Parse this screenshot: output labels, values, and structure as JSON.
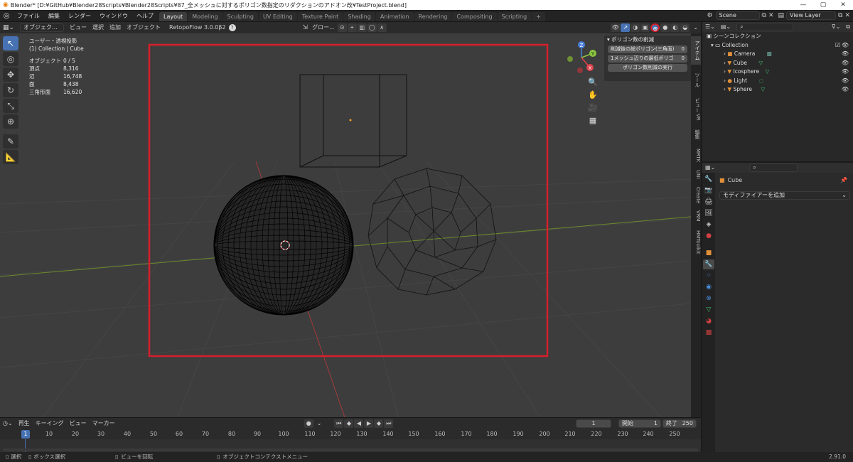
{
  "window": {
    "title": "Blender* [D:¥GitHub¥Blender28Scripts¥Blender28Scripts¥87_全メッシュに対するポリゴン数指定のリダクションのアドオン改¥TestProject.blend]",
    "min": "—",
    "max": "▢",
    "close": "✕"
  },
  "menu": [
    "ファイル",
    "編集",
    "レンダー",
    "ウィンドウ",
    "ヘルプ"
  ],
  "workspaces": [
    "Layout",
    "Modeling",
    "Sculpting",
    "UV Editing",
    "Texture Paint",
    "Shading",
    "Animation",
    "Rendering",
    "Compositing",
    "Scripting"
  ],
  "workspace_add": "+",
  "scene": {
    "name": "Scene",
    "view_layer": "View Layer"
  },
  "viewport_header": {
    "mode": "オブジェク...",
    "menus": [
      "ビュー",
      "選択",
      "追加",
      "オブジェクト"
    ],
    "addon": "RetopoFlow 3.0.0β2",
    "addon_help": "?",
    "transform": "グロー..."
  },
  "overlay_stats": {
    "title": "ユーザー・透視投影",
    "subtitle": "(1) Collection | Cube",
    "rows": [
      {
        "k": "オブジェクト",
        "v": "0 / 5"
      },
      {
        "k": "頂点",
        "v": "8,316"
      },
      {
        "k": "辺",
        "v": "16,748"
      },
      {
        "k": "面",
        "v": "8,438"
      },
      {
        "k": "三角形面",
        "v": "16,620"
      }
    ]
  },
  "gizmo": {
    "z": "Z",
    "y": "Y",
    "x": "X"
  },
  "npanel": {
    "header": "ポリゴン数の削減",
    "fields": [
      {
        "label": "削減後の総ポリゴン(三角面)",
        "value": "0"
      },
      {
        "label": "1メッシュ辺りの最低ポリゴ",
        "value": "0"
      }
    ],
    "run_button": "ポリゴン数削減の実行"
  },
  "side_tabs": [
    "アイテム",
    "ツール",
    "ビュー",
    "VR",
    "編集",
    "MRTK",
    "UNI",
    "Create",
    "VRM",
    "HMToolkit"
  ],
  "outliner": {
    "search_placeholder": "",
    "root": "シーンコレクション",
    "collection": "Collection",
    "items": [
      "Camera",
      "Cube",
      "Icosphere",
      "Light",
      "Sphere"
    ]
  },
  "properties": {
    "search_placeholder": "",
    "object": "Cube",
    "add_modifier": "モディファイアーを追加"
  },
  "timeline": {
    "menus": [
      "再生",
      "キーイング",
      "ビュー",
      "マーカー"
    ],
    "current_frame": "1",
    "start_label": "開始",
    "start": "1",
    "end_label": "終了",
    "end": "250",
    "ticks": [
      "1",
      "10",
      "20",
      "30",
      "40",
      "50",
      "60",
      "70",
      "80",
      "90",
      "100",
      "110",
      "120",
      "130",
      "140",
      "150",
      "160",
      "170",
      "180",
      "190",
      "200",
      "210",
      "220",
      "230",
      "240",
      "250"
    ]
  },
  "status": {
    "select": "選択",
    "box_select": "ボックス選択",
    "rotate": "ビューを回転",
    "context": "オブジェクトコンテクストメニュー",
    "version": "2.91.0"
  },
  "colors": {
    "highlight": "#d71f2b",
    "accent": "#4772b3"
  }
}
